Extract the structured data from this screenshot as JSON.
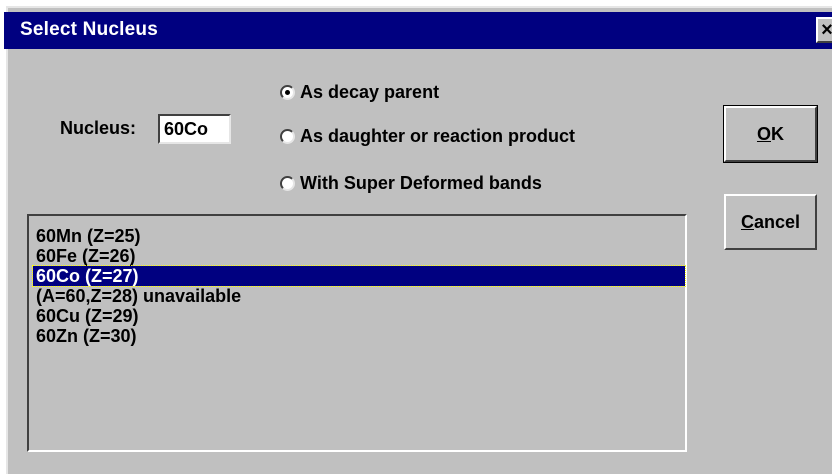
{
  "window": {
    "title": "Select Nucleus",
    "close_label": "×"
  },
  "nucleus": {
    "label": "Nucleus:",
    "value": "60Co"
  },
  "options": [
    {
      "label": "As decay parent",
      "checked": true
    },
    {
      "label": "As daughter or reaction product",
      "checked": false
    },
    {
      "label": "With Super Deformed bands",
      "checked": false
    }
  ],
  "buttons": {
    "ok_mnemonic": "O",
    "ok_rest": "K",
    "cancel_mnemonic": "C",
    "cancel_rest": "ancel"
  },
  "list": {
    "items": [
      "60Mn (Z=25)",
      "60Fe (Z=26)",
      "60Co (Z=27)",
      "(A=60,Z=28) unavailable",
      "60Cu (Z=29)",
      "60Zn (Z=30)"
    ],
    "selected_index": 2
  }
}
